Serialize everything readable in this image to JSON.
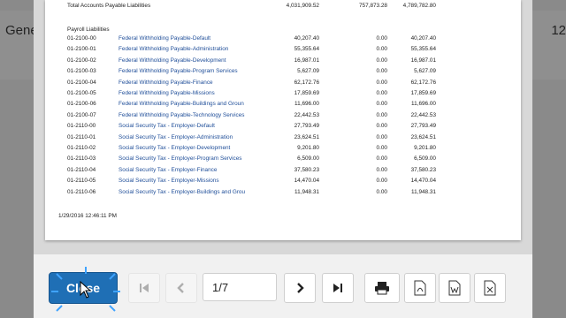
{
  "background": {
    "left_text": "Gene",
    "right_text": "12"
  },
  "report": {
    "total_row": {
      "label": "Total Accounts Payable Liabilities",
      "v1": "4,031,909.52",
      "v2": "757,873.28",
      "v3": "4,789,782.80"
    },
    "section_title": "Payroll Liabilities",
    "rows": [
      {
        "code": "01-2100-00",
        "name": "Federal Withholding Payable-Default",
        "v1": "40,207.40",
        "v2": "0.00",
        "v3": "40,207.40"
      },
      {
        "code": "01-2100-01",
        "name": "Federal Withholding Payable-Administration",
        "v1": "55,355.64",
        "v2": "0.00",
        "v3": "55,355.64"
      },
      {
        "code": "01-2100-02",
        "name": "Federal Withholding Payable-Development",
        "v1": "16,987.01",
        "v2": "0.00",
        "v3": "16,987.01"
      },
      {
        "code": "01-2100-03",
        "name": "Federal Withholding Payable-Program Services",
        "v1": "5,627.09",
        "v2": "0.00",
        "v3": "5,627.09"
      },
      {
        "code": "01-2100-04",
        "name": "Federal Withholding Payable-Finance",
        "v1": "62,172.76",
        "v2": "0.00",
        "v3": "62,172.76"
      },
      {
        "code": "01-2100-05",
        "name": "Federal Withholding Payable-Missions",
        "v1": "17,859.69",
        "v2": "0.00",
        "v3": "17,859.69"
      },
      {
        "code": "01-2100-06",
        "name": "Federal Withholding Payable-Buildings and Groun",
        "v1": "11,696.00",
        "v2": "0.00",
        "v3": "11,696.00"
      },
      {
        "code": "01-2100-07",
        "name": "Federal Withholding Payable-Technology Services",
        "v1": "22,442.53",
        "v2": "0.00",
        "v3": "22,442.53"
      },
      {
        "code": "01-2110-00",
        "name": "Social Security Tax - Employer-Default",
        "v1": "27,793.49",
        "v2": "0.00",
        "v3": "27,793.49"
      },
      {
        "code": "01-2110-01",
        "name": "Social Security Tax - Employer-Administration",
        "v1": "23,624.51",
        "v2": "0.00",
        "v3": "23,624.51"
      },
      {
        "code": "01-2110-02",
        "name": "Social Security Tax - Employer-Development",
        "v1": "9,201.80",
        "v2": "0.00",
        "v3": "9,201.80"
      },
      {
        "code": "01-2110-03",
        "name": "Social Security Tax - Employer-Program Services",
        "v1": "6,509.00",
        "v2": "0.00",
        "v3": "6,509.00"
      },
      {
        "code": "01-2110-04",
        "name": "Social Security Tax - Employer-Finance",
        "v1": "37,580.23",
        "v2": "0.00",
        "v3": "37,580.23"
      },
      {
        "code": "01-2110-05",
        "name": "Social Security Tax - Employer-Missions",
        "v1": "14,470.04",
        "v2": "0.00",
        "v3": "14,470.04"
      },
      {
        "code": "01-2110-06",
        "name": "Social Security Tax - Employer-Buildings and Grou",
        "v1": "11,948.31",
        "v2": "0.00",
        "v3": "11,948.31"
      }
    ],
    "timestamp": "1/29/2016 12:46:11 PM"
  },
  "toolbar": {
    "close_label": "Close",
    "page_indicator": "1/7",
    "icons": [
      "first-page-icon",
      "prev-page-icon",
      "next-page-icon",
      "last-page-icon",
      "print-icon",
      "pdf-icon",
      "word-icon",
      "excel-icon"
    ]
  },
  "colors": {
    "accent": "#1f6fb5",
    "link": "#1f4e99"
  }
}
